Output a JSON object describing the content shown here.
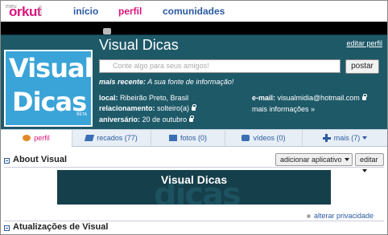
{
  "nav": {
    "logo_meu": "meu",
    "logo_text": "orkut",
    "logo_beta": "BETA",
    "links": [
      "início",
      "perfil",
      "comunidades"
    ]
  },
  "profile": {
    "name": "Visual Dicas",
    "edit_link": "editar perfil",
    "avatar_line1": "Visual",
    "avatar_line2": "Dicas",
    "avatar_tiny": "BETA",
    "status_placeholder": "Conte algo para seus amigos!",
    "post_button": "postar",
    "recent_label": "mais recente:",
    "recent_value": "A sua fonte de informação!",
    "local_label": "local:",
    "local_value": "Ribeirão Preto, Brasil",
    "relationship_label": "relacionamento:",
    "relationship_value": "solteiro(a)",
    "birthday_label": "aniversário:",
    "birthday_value": "20 de outubro",
    "email_label": "e-mail:",
    "email_value": "visualmidia@hotmail.com",
    "more_info": "mais informações »"
  },
  "tabs": [
    {
      "label": "perfil",
      "icon": "user-icon"
    },
    {
      "label": "recados (77)",
      "icon": "scrap-icon"
    },
    {
      "label": "fotos (0)",
      "icon": "photo-icon"
    },
    {
      "label": "vídeos (0)",
      "icon": "video-icon"
    },
    {
      "label": "mais (7)",
      "icon": "plus-icon"
    }
  ],
  "about": {
    "title": "About Visual",
    "add_app_button": "adicionar aplicativo",
    "edit_button": "editar",
    "banner_text": "Visual Dicas"
  },
  "updates": {
    "title": "Atualizações de Visual",
    "privacy_link": "alterar privacidade"
  },
  "colors": {
    "brand_pink": "#d9167b",
    "link_blue": "#2c5aa0",
    "profile_teal": "#1e5968",
    "avatar_blue": "#3aa4d8"
  }
}
